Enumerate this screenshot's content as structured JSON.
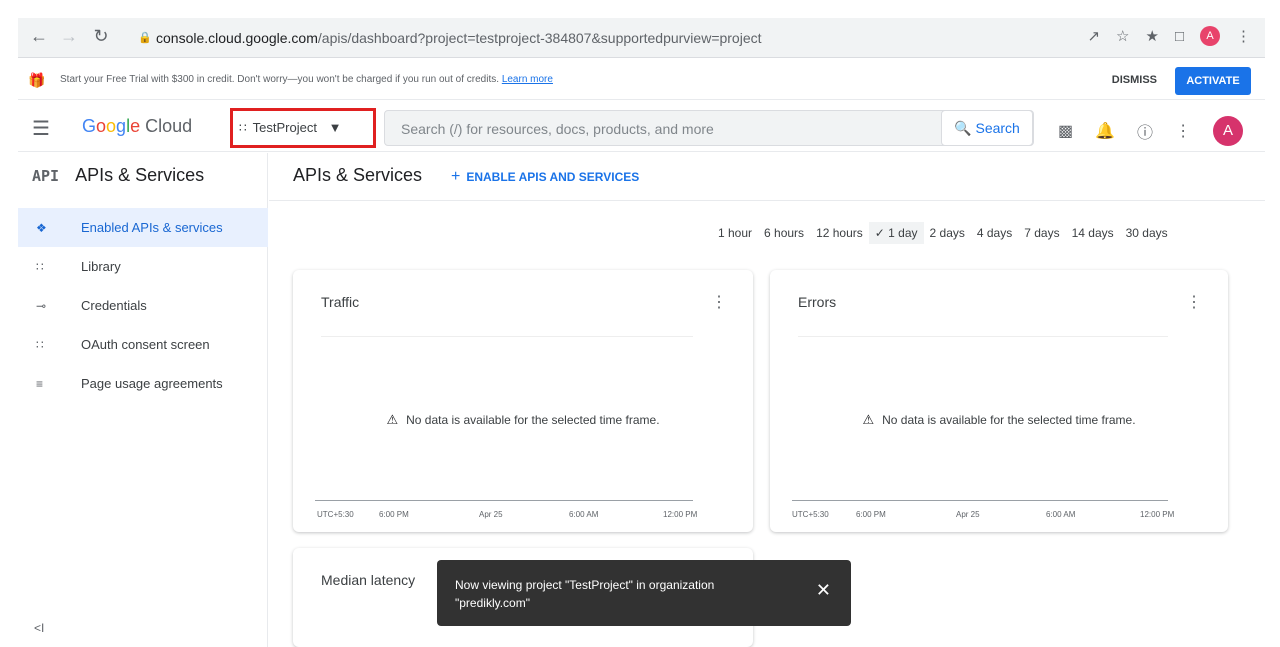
{
  "browser": {
    "url_host": "console.cloud.google.com",
    "url_path": "/apis/dashboard?project=testproject-384807&supportedpurview=project",
    "avatar_letter": "A"
  },
  "promo": {
    "text": "Start your Free Trial with $300 in credit. Don't worry—you won't be charged if you run out of credits.",
    "learn_more": "Learn more",
    "dismiss": "DISMISS",
    "activate": "ACTIVATE"
  },
  "topbar": {
    "logo_google": "Google",
    "logo_cloud": "Cloud",
    "project_name": "TestProject",
    "search_placeholder": "Search (/) for resources, docs, products, and more",
    "search_button": "Search",
    "avatar_letter": "A"
  },
  "sidebar": {
    "icon_text": "API",
    "title": "APIs & Services",
    "items": [
      {
        "label": "Enabled APIs & services",
        "icon": "diamond-nodes-icon",
        "active": true
      },
      {
        "label": "Library",
        "icon": "library-grid-icon",
        "active": false
      },
      {
        "label": "Credentials",
        "icon": "key-icon",
        "active": false
      },
      {
        "label": "OAuth consent screen",
        "icon": "consent-icon",
        "active": false
      },
      {
        "label": "Page usage agreements",
        "icon": "settings-list-icon",
        "active": false
      }
    ],
    "collapse": "<I"
  },
  "main": {
    "title": "APIs & Services",
    "enable_button": "ENABLE APIS AND SERVICES",
    "time_ranges": [
      "1 hour",
      "6 hours",
      "12 hours",
      "1 day",
      "2 days",
      "4 days",
      "7 days",
      "14 days",
      "30 days"
    ],
    "selected_time_range": "1 day",
    "selected_label": "✓ 1 day",
    "cards": [
      {
        "title": "Traffic",
        "message": "No data is available for the selected time frame.",
        "ticks": [
          "UTC+5:30",
          "6:00 PM",
          "Apr 25",
          "6:00 AM",
          "12:00 PM"
        ]
      },
      {
        "title": "Errors",
        "message": "No data is available for the selected time frame.",
        "ticks": [
          "UTC+5:30",
          "6:00 PM",
          "Apr 25",
          "6:00 AM",
          "12:00 PM"
        ]
      },
      {
        "title": "Median latency"
      }
    ]
  },
  "toast": {
    "text": "Now viewing project \"TestProject\" in organization \"predikly.com\"",
    "close": "✕"
  }
}
